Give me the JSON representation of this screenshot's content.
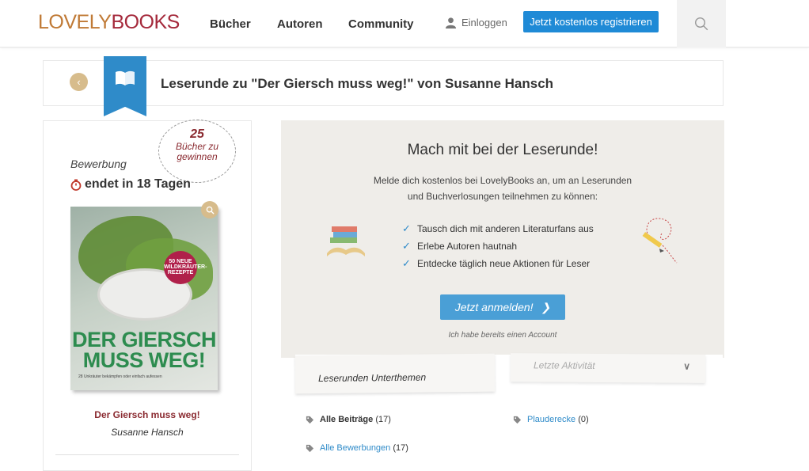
{
  "header": {
    "logo_part1": "LOVELY",
    "logo_part2": "BOOKS",
    "nav": [
      "Bücher",
      "Autoren",
      "Community"
    ],
    "login_label": "Einloggen",
    "register_label": "Jetzt kostenlos registrieren"
  },
  "title_strip": {
    "title": "Leserunde zu \"Der Giersch muss weg!\" von Susanne Hansch"
  },
  "sidebar": {
    "badge_count": "25",
    "badge_text": "Bücher zu gewinnen",
    "bewerbung": "Bewerbung",
    "endet": "endet in 18 Tagen",
    "book_title": "Der Giersch muss weg!",
    "book_author": "Susanne Hansch",
    "cover": {
      "title_line1": "DER GIERSCH",
      "title_line2": "MUSS WEG!",
      "badge": "50 NEUE WILDKRÄUTER-REZEPTE",
      "subtitle": "28 Unkräuter bekämpfen oder einfach aufessen"
    }
  },
  "promo": {
    "title": "Mach mit bei der Leserunde!",
    "text_line1": "Melde dich kostenlos bei LovelyBooks an, um an Leserunden",
    "text_line2": "und Buchverlosungen teilnehmen zu können:",
    "benefits": [
      "Tausch dich mit anderen Literaturfans aus",
      "Erlebe Autoren hautnah",
      "Entdecke täglich neue Aktionen für Leser"
    ],
    "cta_label": "Jetzt anmelden!",
    "account_link": "Ich habe bereits einen Account"
  },
  "tabs": {
    "active_tab": "Leserunden Unterthemen",
    "sort_placeholder": "Letzte Aktivität"
  },
  "topics": [
    {
      "name": "Alle Beiträge",
      "count": "(17)"
    },
    {
      "name": "Plauderecke",
      "count": "(0)"
    },
    {
      "name": "Alle Bewerbungen",
      "count": "(17)"
    }
  ],
  "colors": {
    "brand_orange": "#c07a36",
    "brand_red": "#a52a3c",
    "accent_blue": "#1f8ad6"
  }
}
